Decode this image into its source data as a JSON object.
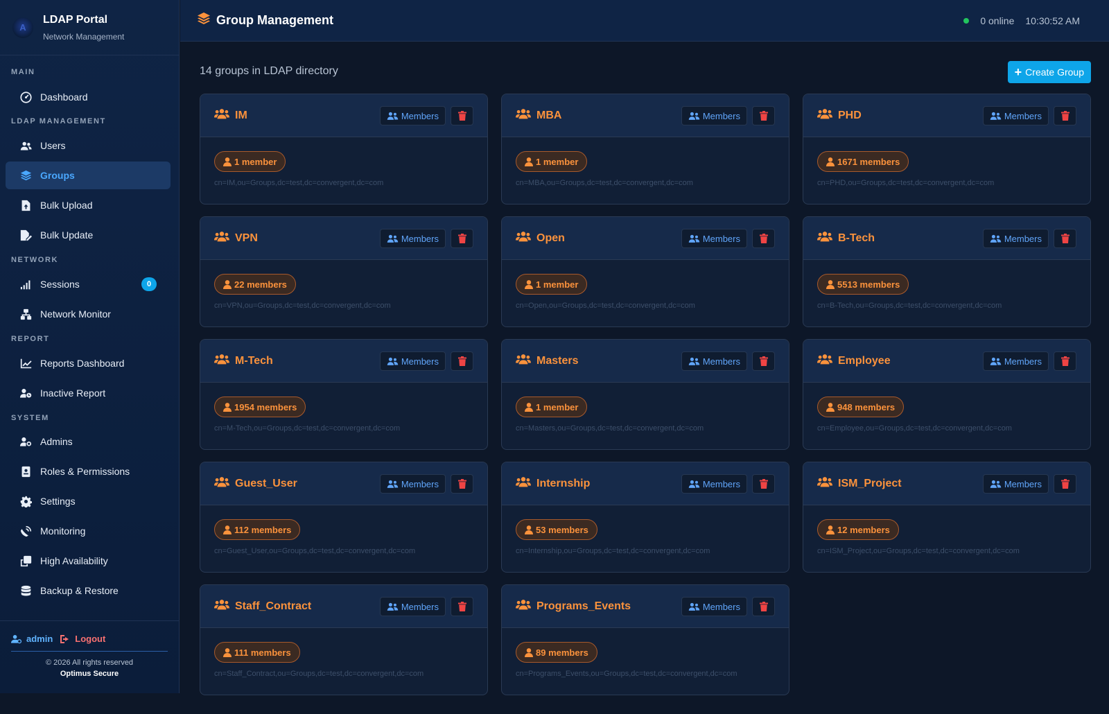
{
  "brand": {
    "title": "LDAP Portal",
    "subtitle": "Network Management",
    "logo_text": "A"
  },
  "sidebar": {
    "sections": [
      {
        "label": "MAIN",
        "items": [
          {
            "label": "Dashboard",
            "icon": "dashboard-icon"
          }
        ]
      },
      {
        "label": "LDAP MANAGEMENT",
        "items": [
          {
            "label": "Users",
            "icon": "users-icon"
          },
          {
            "label": "Groups",
            "icon": "layers-icon",
            "active": true
          },
          {
            "label": "Bulk Upload",
            "icon": "file-upload-icon"
          },
          {
            "label": "Bulk Update",
            "icon": "file-edit-icon"
          }
        ]
      },
      {
        "label": "NETWORK",
        "items": [
          {
            "label": "Sessions",
            "icon": "signal-icon",
            "badge": "0"
          },
          {
            "label": "Network Monitor",
            "icon": "network-icon"
          }
        ]
      },
      {
        "label": "REPORT",
        "items": [
          {
            "label": "Reports Dashboard",
            "icon": "chart-line-icon"
          },
          {
            "label": "Inactive Report",
            "icon": "user-clock-icon"
          }
        ]
      },
      {
        "label": "SYSTEM",
        "items": [
          {
            "label": "Admins",
            "icon": "user-gear-icon"
          },
          {
            "label": "Roles & Permissions",
            "icon": "id-badge-icon"
          },
          {
            "label": "Settings",
            "icon": "gear-icon"
          },
          {
            "label": "Monitoring",
            "icon": "satellite-dish-icon"
          },
          {
            "label": "High Availability",
            "icon": "clone-icon"
          },
          {
            "label": "Backup & Restore",
            "icon": "database-icon"
          }
        ]
      }
    ],
    "footer": {
      "user": "admin",
      "logout": "Logout",
      "copyright": "© 2026 All rights reserved",
      "company": "Optimus Secure"
    }
  },
  "header": {
    "title": "Group Management",
    "online": "0 online",
    "time": "10:30:52 AM"
  },
  "main": {
    "summary": "14 groups in LDAP directory",
    "create_label": "Create Group",
    "members_label": "Members",
    "groups": [
      {
        "name": "IM",
        "count": "1 member",
        "dn": "cn=IM,ou=Groups,dc=test,dc=convergent,dc=com"
      },
      {
        "name": "MBA",
        "count": "1 member",
        "dn": "cn=MBA,ou=Groups,dc=test,dc=convergent,dc=com"
      },
      {
        "name": "PHD",
        "count": "1671 members",
        "dn": "cn=PHD,ou=Groups,dc=test,dc=convergent,dc=com"
      },
      {
        "name": "VPN",
        "count": "22 members",
        "dn": "cn=VPN,ou=Groups,dc=test,dc=convergent,dc=com"
      },
      {
        "name": "Open",
        "count": "1 member",
        "dn": "cn=Open,ou=Groups,dc=test,dc=convergent,dc=com"
      },
      {
        "name": "B-Tech",
        "count": "5513 members",
        "dn": "cn=B-Tech,ou=Groups,dc=test,dc=convergent,dc=com"
      },
      {
        "name": "M-Tech",
        "count": "1954 members",
        "dn": "cn=M-Tech,ou=Groups,dc=test,dc=convergent,dc=com"
      },
      {
        "name": "Masters",
        "count": "1 member",
        "dn": "cn=Masters,ou=Groups,dc=test,dc=convergent,dc=com"
      },
      {
        "name": "Employee",
        "count": "948 members",
        "dn": "cn=Employee,ou=Groups,dc=test,dc=convergent,dc=com"
      },
      {
        "name": "Guest_User",
        "count": "112 members",
        "dn": "cn=Guest_User,ou=Groups,dc=test,dc=convergent,dc=com"
      },
      {
        "name": "Internship",
        "count": "53 members",
        "dn": "cn=Internship,ou=Groups,dc=test,dc=convergent,dc=com"
      },
      {
        "name": "ISM_Project",
        "count": "12 members",
        "dn": "cn=ISM_Project,ou=Groups,dc=test,dc=convergent,dc=com"
      },
      {
        "name": "Staff_Contract",
        "count": "111 members",
        "dn": "cn=Staff_Contract,ou=Groups,dc=test,dc=convergent,dc=com"
      },
      {
        "name": "Programs_Events",
        "count": "89 members",
        "dn": "cn=Programs_Events,ou=Groups,dc=test,dc=convergent,dc=com"
      }
    ]
  },
  "colors": {
    "accent": "#0ea5e9",
    "group_orange": "#fb923c",
    "members_blue": "#60a5fa",
    "delete_red": "#ef4444",
    "online_green": "#22c55e"
  }
}
